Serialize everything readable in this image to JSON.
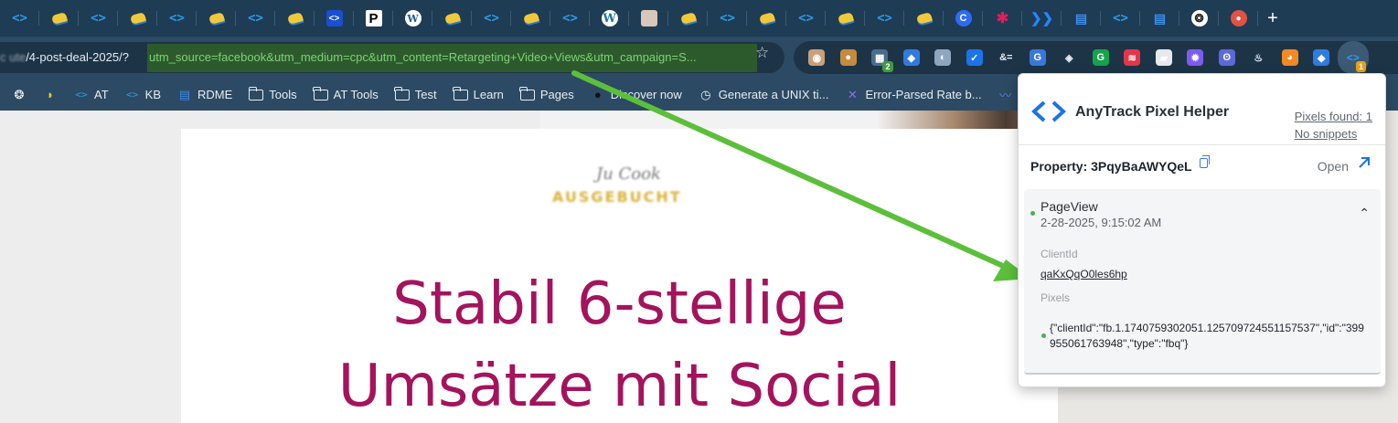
{
  "tabs": [
    {
      "icon": "code-icon"
    },
    {
      "icon": "bird-icon"
    },
    {
      "icon": "code-icon"
    },
    {
      "icon": "bird-icon"
    },
    {
      "icon": "code-icon"
    },
    {
      "icon": "bird-icon"
    },
    {
      "icon": "code-icon"
    },
    {
      "icon": "bird-icon"
    },
    {
      "icon": "code-box-icon"
    },
    {
      "icon": "p-logo-icon"
    },
    {
      "icon": "w-logo-icon"
    },
    {
      "icon": "bird-icon"
    },
    {
      "icon": "code-icon"
    },
    {
      "icon": "bird-icon"
    },
    {
      "icon": "code-icon"
    },
    {
      "icon": "wordpress-icon"
    },
    {
      "icon": "image-icon"
    },
    {
      "icon": "bird-icon"
    },
    {
      "icon": "code-icon"
    },
    {
      "icon": "bird-icon"
    },
    {
      "icon": "code-icon"
    },
    {
      "icon": "bird-icon"
    },
    {
      "icon": "code-icon"
    },
    {
      "icon": "bird-icon"
    },
    {
      "icon": "c-logo-icon"
    },
    {
      "icon": "slack-icon"
    },
    {
      "icon": "jira-icon"
    },
    {
      "icon": "book-icon"
    },
    {
      "icon": "code-icon"
    },
    {
      "icon": "book-icon"
    },
    {
      "icon": "chatgpt-icon"
    },
    {
      "icon": "red-circle-icon"
    }
  ],
  "new_tab_label": "+",
  "address": {
    "host": "c  ute",
    "path": "/4-post-deal-2025/?",
    "query": "utm_source=facebook&utm_medium=cpc&utm_content=Retargeting+Video+Views&utm_campaign=S..."
  },
  "extensions": [
    {
      "icon": "face-icon",
      "color": "#c9a07a",
      "glyph": "◉"
    },
    {
      "icon": "cookie-icon",
      "color": "#c48a3e",
      "glyph": "●"
    },
    {
      "icon": "grid-ext-icon",
      "color": "#4a6c8c",
      "glyph": "▦",
      "badge": "2",
      "badge_color": "#3f9b3a"
    },
    {
      "icon": "tag-icon",
      "color": "#2f7ce0",
      "glyph": "◆"
    },
    {
      "icon": "globe-icon",
      "color": "#8fa6bf",
      "glyph": "◐"
    },
    {
      "icon": "shield-check-icon",
      "color": "#1b74e8",
      "glyph": "✓"
    },
    {
      "icon": "ampersand-icon",
      "color": "transparent",
      "glyph": "&="
    },
    {
      "icon": "translate-icon",
      "color": "#3a78d8",
      "glyph": "G"
    },
    {
      "icon": "layers-icon",
      "color": "transparent",
      "glyph": "◈"
    },
    {
      "icon": "grammarly-icon",
      "color": "#16a34a",
      "glyph": "G"
    },
    {
      "icon": "scroll-icon",
      "color": "#e2364a",
      "glyph": "≋"
    },
    {
      "icon": "eraser-icon",
      "color": "#e7e9ec",
      "glyph": "▰"
    },
    {
      "icon": "spark-icon",
      "color": "#7c5cf0",
      "glyph": "✹"
    },
    {
      "icon": "monster-icon",
      "color": "#5c6ad8",
      "glyph": "ʘ"
    },
    {
      "icon": "flame-icon",
      "color": "transparent",
      "glyph": "♨"
    },
    {
      "icon": "fox-icon",
      "color": "#f08a24",
      "glyph": "◕"
    },
    {
      "icon": "tag-icon",
      "color": "#2f7ce0",
      "glyph": "◆"
    },
    {
      "icon": "anytrack-icon",
      "color": "#2b9be6",
      "glyph": "<>",
      "badge": "1",
      "badge_color": "#e8a317",
      "active": true
    }
  ],
  "bookmarks": [
    {
      "icon": "chatgpt-icon",
      "label": ""
    },
    {
      "icon": "bird-icon",
      "label": ""
    },
    {
      "icon": "code-icon",
      "label": "AT"
    },
    {
      "icon": "code-icon",
      "label": "KB"
    },
    {
      "icon": "book-icon",
      "label": "RDME"
    },
    {
      "icon": "folder-icon",
      "label": "Tools"
    },
    {
      "icon": "folder-icon",
      "label": "AT Tools"
    },
    {
      "icon": "folder-icon",
      "label": "Test"
    },
    {
      "icon": "folder-icon",
      "label": "Learn"
    },
    {
      "icon": "folder-icon",
      "label": "Pages"
    },
    {
      "icon": "dot-icon",
      "label": "Discover now"
    },
    {
      "icon": "clock-icon",
      "label": "Generate a UNIX ti..."
    },
    {
      "icon": "x-icon",
      "label": "Error-Parsed Rate b..."
    },
    {
      "icon": "wave-icon",
      "label": ""
    }
  ],
  "page": {
    "logo_signature": "Ju Cook",
    "logo_word": "AUSGEBUCHT",
    "headline_line1": "Stabil 6-stellige",
    "headline_line2": "Umsätze mit Social"
  },
  "popup": {
    "title": "AnyTrack Pixel Helper",
    "pixels_found": "Pixels found: 1",
    "no_snippets": "No snippets",
    "property_label": "Property: 3PqyBaAWYQeL",
    "open_label": "Open",
    "event": {
      "name": "PageView",
      "time": "2-28-2025, 9:15:02 AM",
      "client_id_label": "ClientId",
      "client_id_value": "qaKxQqO0les6hp",
      "pixels_label": "Pixels",
      "pixels_value": "{\"clientId\":\"fb.1.1740759302051.125709724551157537\",\"id\":\"399955061763948\",\"type\":\"fbq\"}"
    }
  },
  "colors": {
    "headline": "#a3145d",
    "annotation_arrow": "#5cbf3a",
    "url_highlight": "#2d5a2c"
  }
}
